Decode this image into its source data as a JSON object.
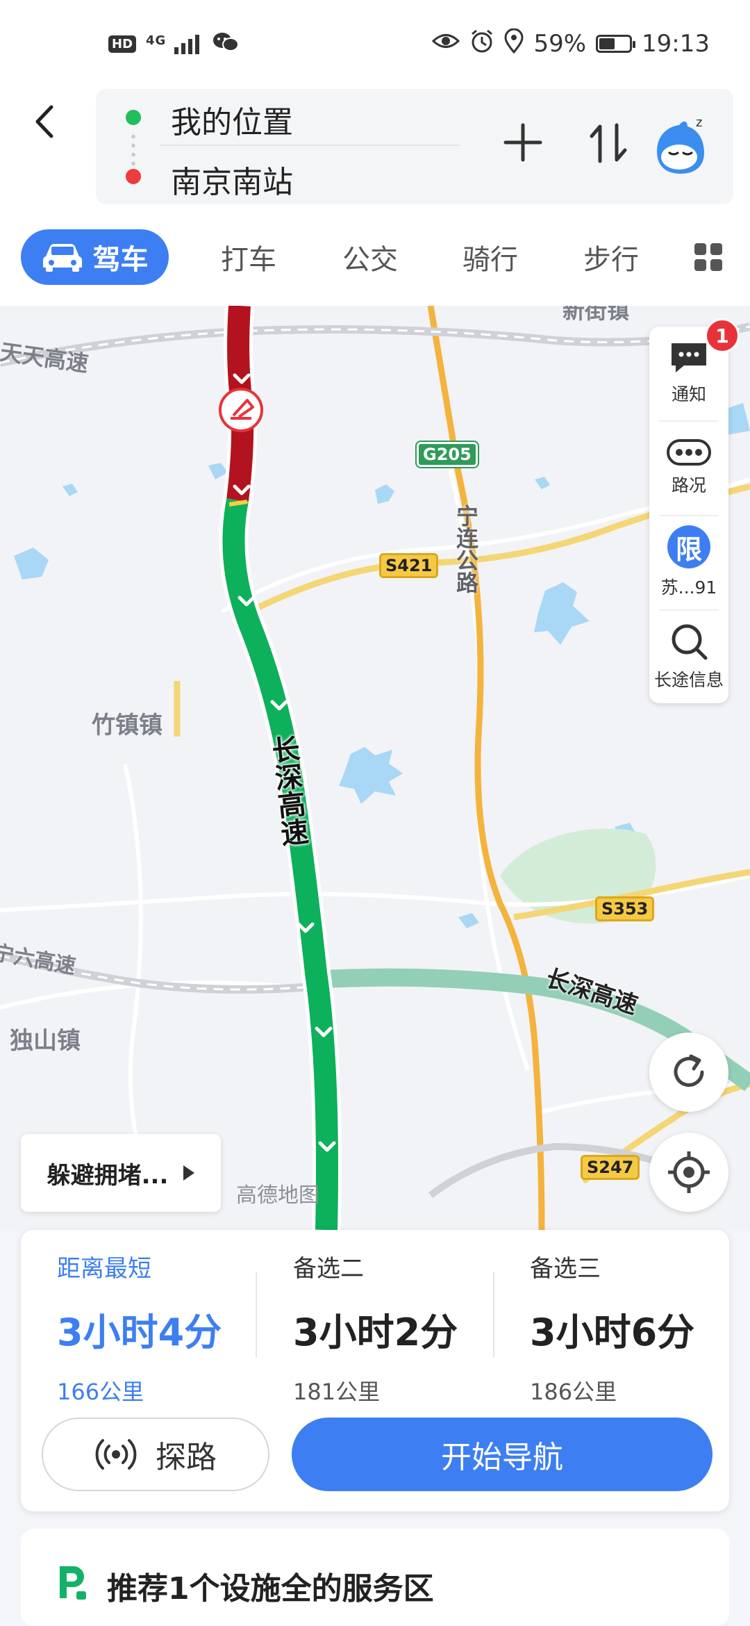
{
  "status_bar": {
    "hd": "HD",
    "network": "4G",
    "battery_text": "59%",
    "battery_level": 0.59,
    "time": "19:13"
  },
  "route": {
    "origin": "我的位置",
    "destination": "南京南站",
    "origin_color": "#1fbf5b",
    "destination_color": "#ee3b3b"
  },
  "tabs": {
    "active": "驾车",
    "items": [
      "打车",
      "公交",
      "骑行",
      "步行"
    ]
  },
  "map": {
    "labels": {
      "tiantian": "天天高速",
      "xinjie": "新街镇",
      "zhuzhen": "竹镇镇",
      "dushan": "独山镇",
      "chang6": "宁六高速",
      "ninglian": "宁连公路",
      "changshen_main": "长深高速",
      "changshen_side": "长深高速",
      "amap": "高德地图"
    },
    "shields": {
      "g205": "G205",
      "s421": "S421",
      "s353": "S353",
      "s247": "S247"
    }
  },
  "side_panel": {
    "notify_label": "通知",
    "notify_badge": "1",
    "traffic_label": "路况",
    "limit_icon_text": "限",
    "limit_label": "苏...91",
    "longtrip_label": "长途信息"
  },
  "avoid_button": {
    "label": "躲避拥堵..."
  },
  "route_options": [
    {
      "title": "距离最短",
      "time": "3小时4分",
      "distance": "166公里"
    },
    {
      "title": "备选二",
      "time": "3小时2分",
      "distance": "181公里"
    },
    {
      "title": "备选三",
      "time": "3小时6分",
      "distance": "186公里"
    }
  ],
  "actions": {
    "explore_label": "探路",
    "navigate_label": "开始导航"
  },
  "service": {
    "text": "推荐1个设施全的服务区"
  },
  "colors": {
    "accent": "#3d7ff2",
    "route_green": "#0db05b",
    "route_red": "#b3121f"
  }
}
